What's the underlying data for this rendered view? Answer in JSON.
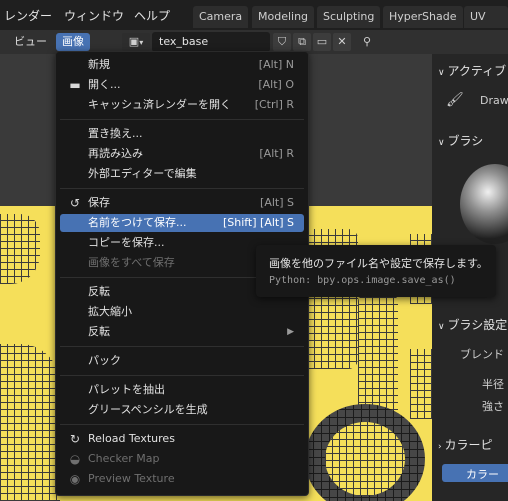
{
  "topbar": {
    "menus": [
      "レンダー",
      "ウィンドウ",
      "ヘルプ"
    ],
    "workspace_tabs": [
      "Camera",
      "Modeling",
      "Sculpting",
      "HyperShade",
      "UV Editi"
    ]
  },
  "image_header": {
    "view_label": "ビュー",
    "image_label": "画像",
    "image_name": "tex_base"
  },
  "dropdown": {
    "new": {
      "label": "新規",
      "shortcut": "[Alt] N"
    },
    "open": {
      "label": "開く...",
      "shortcut": "[Alt] O"
    },
    "open_cached": {
      "label": "キャッシュ済レンダーを開く",
      "shortcut": "[Ctrl] R"
    },
    "replace": {
      "label": "置き換え..."
    },
    "reload": {
      "label": "再読み込み",
      "shortcut": "[Alt] R"
    },
    "edit_external": {
      "label": "外部エディターで編集"
    },
    "save": {
      "label": "保存",
      "shortcut": "[Alt] S"
    },
    "save_as": {
      "label": "名前をつけて保存...",
      "shortcut": "[Shift] [Alt] S"
    },
    "save_copy": {
      "label": "コピーを保存..."
    },
    "save_all": {
      "label": "画像をすべて保存"
    },
    "flip": {
      "label": "反転"
    },
    "resize": {
      "label": "拡大縮小"
    },
    "invert": {
      "label": "反転"
    },
    "pack": {
      "label": "パック"
    },
    "extract_palette": {
      "label": "パレットを抽出"
    },
    "generate_gp": {
      "label": "グリースペンシルを生成"
    },
    "reload_textures": {
      "label": "Reload Textures"
    },
    "checker_map": {
      "label": "Checker Map"
    },
    "preview_texture": {
      "label": "Preview Texture"
    }
  },
  "tooltip": {
    "description": "画像を他のファイル名や設定で保存します。",
    "python": "Python: bpy.ops.image.save_as()"
  },
  "sidebar": {
    "active_tool_header": "アクティブ",
    "tool_name": "Draw",
    "brush_header": "ブラシ",
    "brush_settings_header": "ブラシ設定",
    "blend_label": "ブレンド",
    "radius_label": "半径",
    "strength_label": "強さ",
    "color_header": "カラーピ",
    "color_tab": "カラー"
  },
  "colors": {
    "accent": "#4772b3",
    "canvas": "#f5df5a",
    "menu_bg": "#181818"
  }
}
